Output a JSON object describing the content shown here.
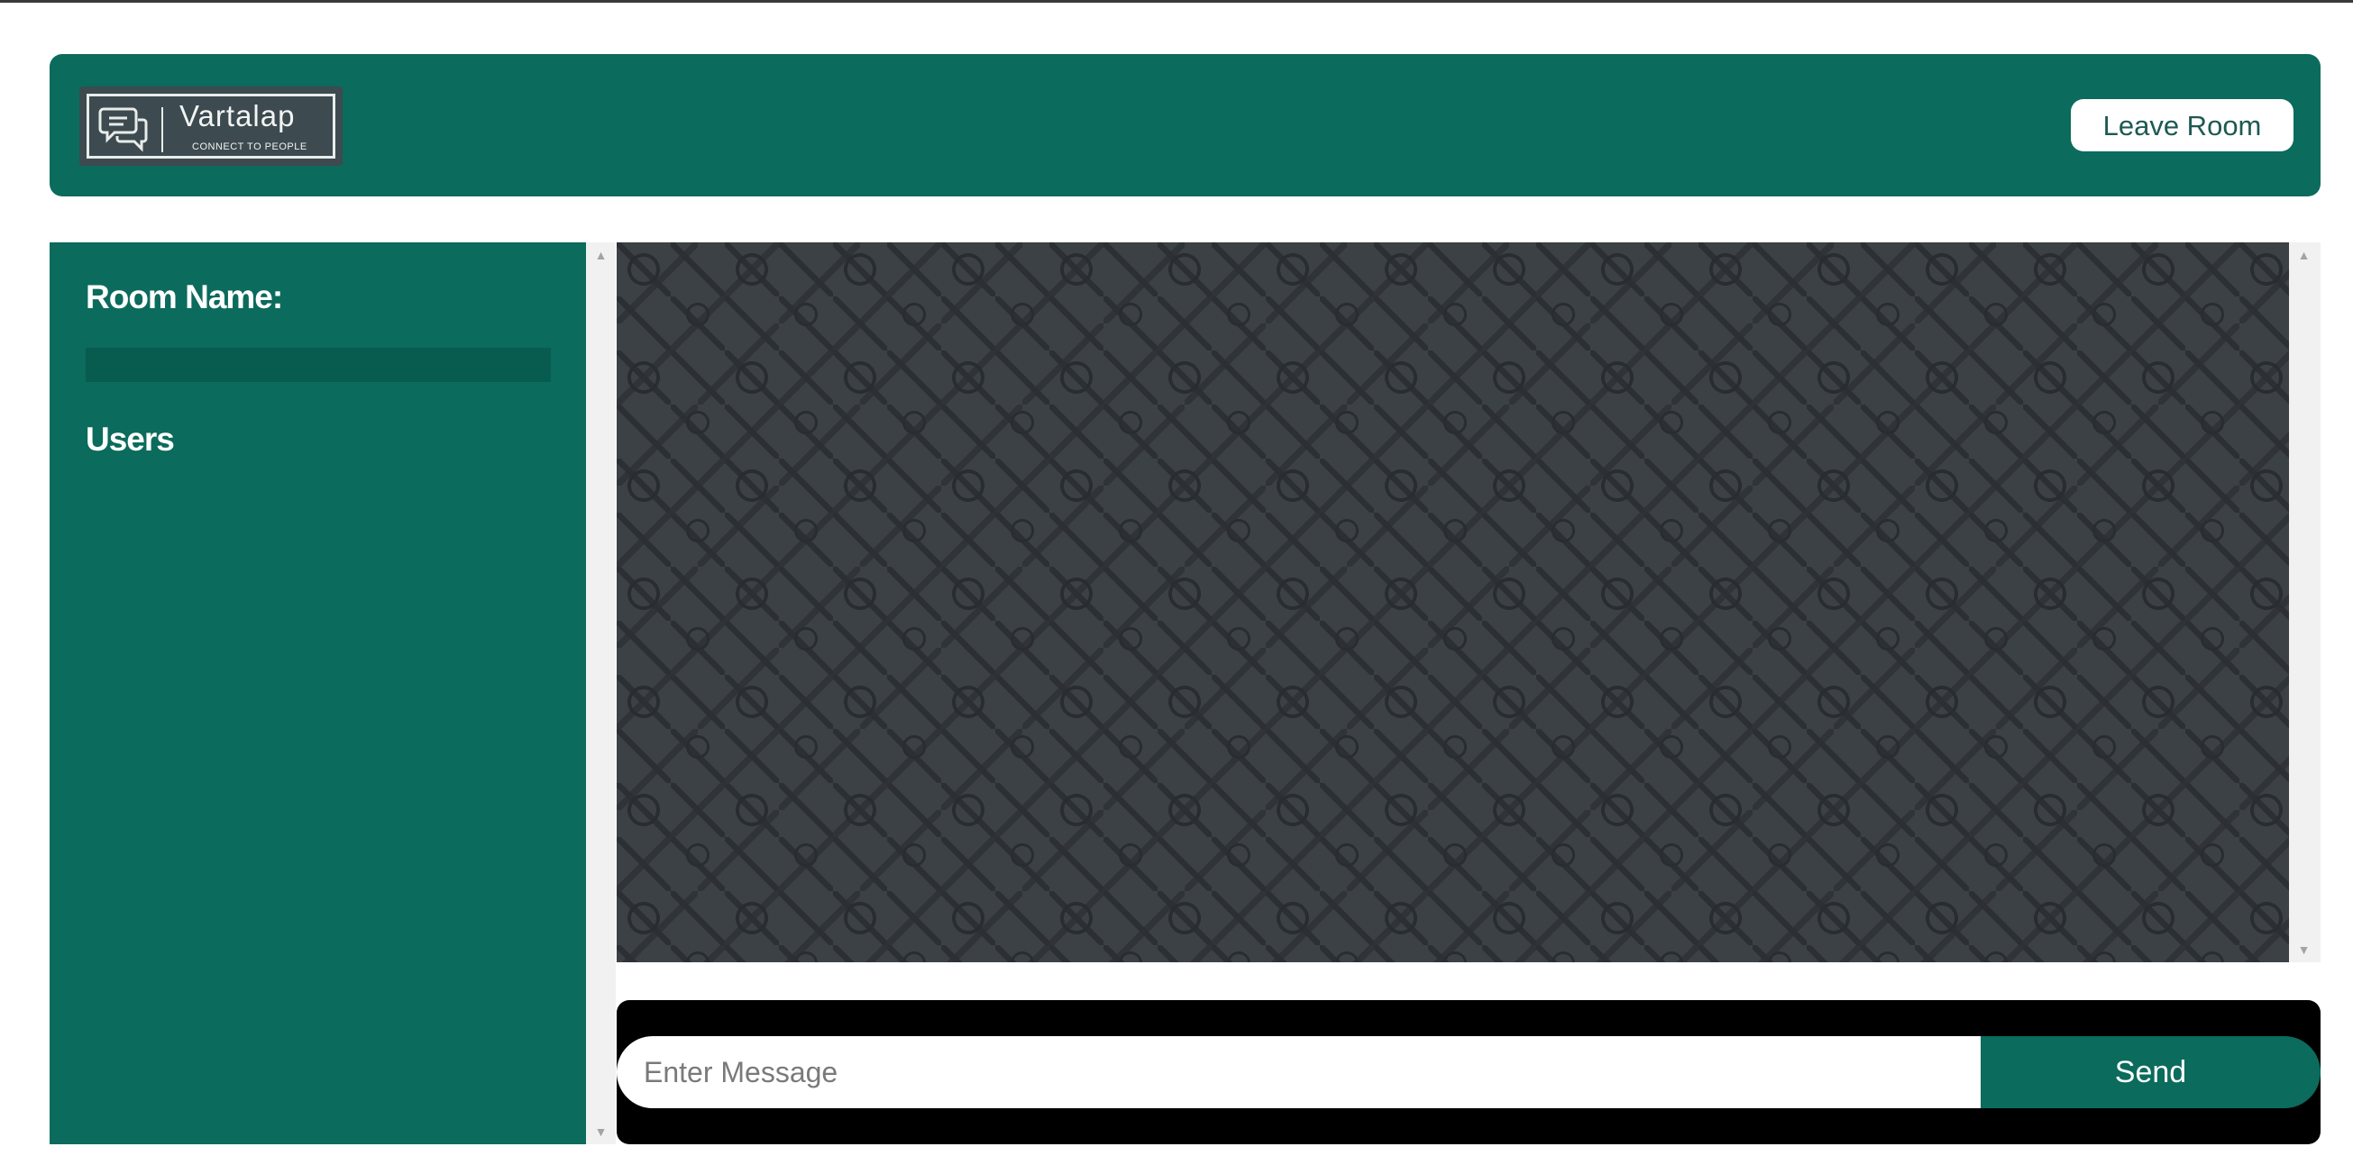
{
  "header": {
    "logo": {
      "name": "Vartalap",
      "tagline": "CONNECT TO PEOPLE",
      "icon": "chat-bubbles-icon"
    },
    "leave_label": "Leave Room"
  },
  "sidebar": {
    "room_name_label": "Room Name:",
    "room_name_value": "",
    "users_label": "Users",
    "users": []
  },
  "chat": {
    "messages": [],
    "background": "doodle-pattern"
  },
  "composer": {
    "placeholder": "Enter Message",
    "value": "",
    "send_label": "Send"
  },
  "colors": {
    "primary": "#0b6b5c",
    "chat_background": "#3c4145",
    "composer_background": "#000000"
  }
}
